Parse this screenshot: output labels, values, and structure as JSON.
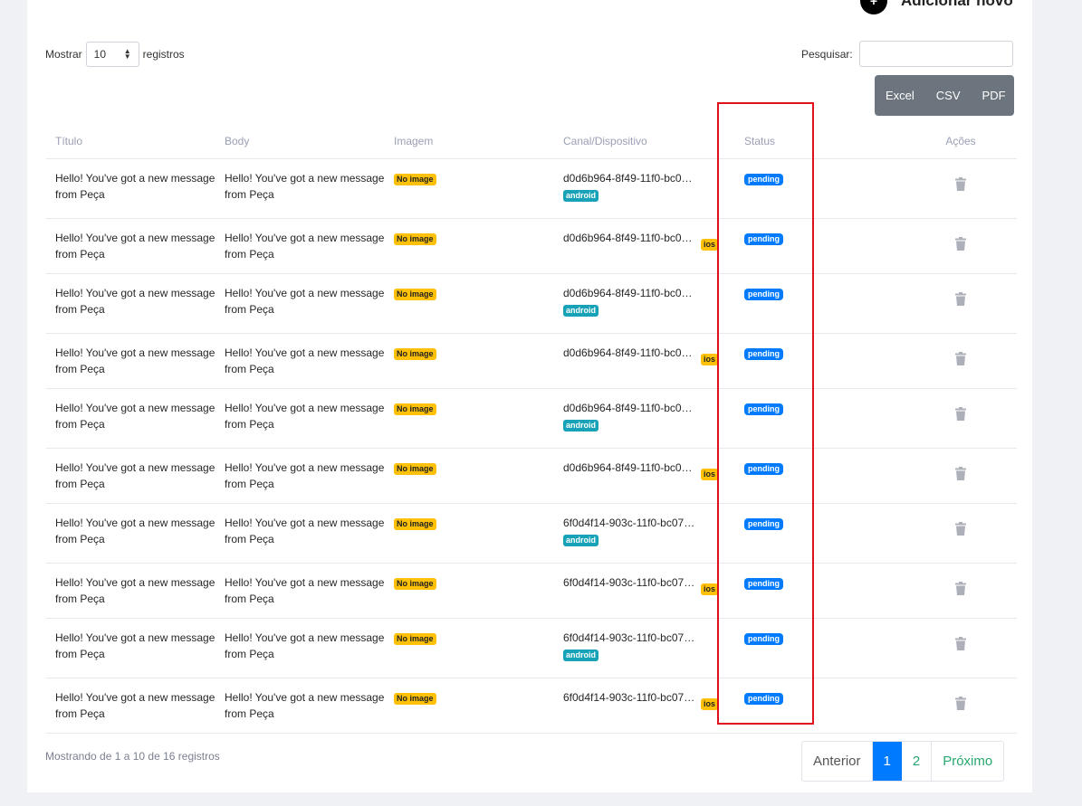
{
  "header": {
    "add_new_label": "Adicionar novo",
    "add_icon": "+"
  },
  "length_menu": {
    "prefix": "Mostrar",
    "value": "10",
    "suffix": "registros"
  },
  "search": {
    "label": "Pesquisar:",
    "value": ""
  },
  "export_buttons": [
    "Excel",
    "CSV",
    "PDF"
  ],
  "columns": [
    "Título",
    "Body",
    "Imagem",
    "Canal/Dispositivo",
    "Status",
    "Ações"
  ],
  "rows": [
    {
      "titulo": "Hello! You've got a new message from Peça",
      "body": "Hello! You've got a new message from Peça",
      "imagem": "No image",
      "canal": "d0d6b964-8f49-11f0-bc0…",
      "device": "android",
      "status": "pending"
    },
    {
      "titulo": "Hello! You've got a new message from Peça",
      "body": "Hello! You've got a new message from Peça",
      "imagem": "No image",
      "canal": "d0d6b964-8f49-11f0-bc0…",
      "device": "ios",
      "status": "pending"
    },
    {
      "titulo": "Hello! You've got a new message from Peça",
      "body": "Hello! You've got a new message from Peça",
      "imagem": "No image",
      "canal": "d0d6b964-8f49-11f0-bc0…",
      "device": "android",
      "status": "pending"
    },
    {
      "titulo": "Hello! You've got a new message from Peça",
      "body": "Hello! You've got a new message from Peça",
      "imagem": "No image",
      "canal": "d0d6b964-8f49-11f0-bc0…",
      "device": "ios",
      "status": "pending"
    },
    {
      "titulo": "Hello! You've got a new message from Peça",
      "body": "Hello! You've got a new message from Peça",
      "imagem": "No image",
      "canal": "d0d6b964-8f49-11f0-bc0…",
      "device": "android",
      "status": "pending"
    },
    {
      "titulo": "Hello! You've got a new message from Peça",
      "body": "Hello! You've got a new message from Peça",
      "imagem": "No image",
      "canal": "d0d6b964-8f49-11f0-bc0…",
      "device": "ios",
      "status": "pending"
    },
    {
      "titulo": "Hello! You've got a new message from Peça",
      "body": "Hello! You've got a new message from Peça",
      "imagem": "No image",
      "canal": "6f0d4f14-903c-11f0-bc07…",
      "device": "android",
      "status": "pending"
    },
    {
      "titulo": "Hello! You've got a new message from Peça",
      "body": "Hello! You've got a new message from Peça",
      "imagem": "No image",
      "canal": "6f0d4f14-903c-11f0-bc07…",
      "device": "ios",
      "status": "pending"
    },
    {
      "titulo": "Hello! You've got a new message from Peça",
      "body": "Hello! You've got a new message from Peça",
      "imagem": "No image",
      "canal": "6f0d4f14-903c-11f0-bc07…",
      "device": "android",
      "status": "pending"
    },
    {
      "titulo": "Hello! You've got a new message from Peça",
      "body": "Hello! You've got a new message from Peça",
      "imagem": "No image",
      "canal": "6f0d4f14-903c-11f0-bc07…",
      "device": "ios",
      "status": "pending"
    }
  ],
  "info": "Mostrando de 1 a 10 de 16 registros",
  "pagination": {
    "prev": "Anterior",
    "pages": [
      "1",
      "2"
    ],
    "active_page": "1",
    "next": "Próximo"
  },
  "colors": {
    "pending": "#007bff",
    "android": "#17a2b8",
    "warning": "#ffc107",
    "highlight": "#e0111b",
    "export_bg": "#6c757d",
    "pager_link": "#28a76f"
  }
}
